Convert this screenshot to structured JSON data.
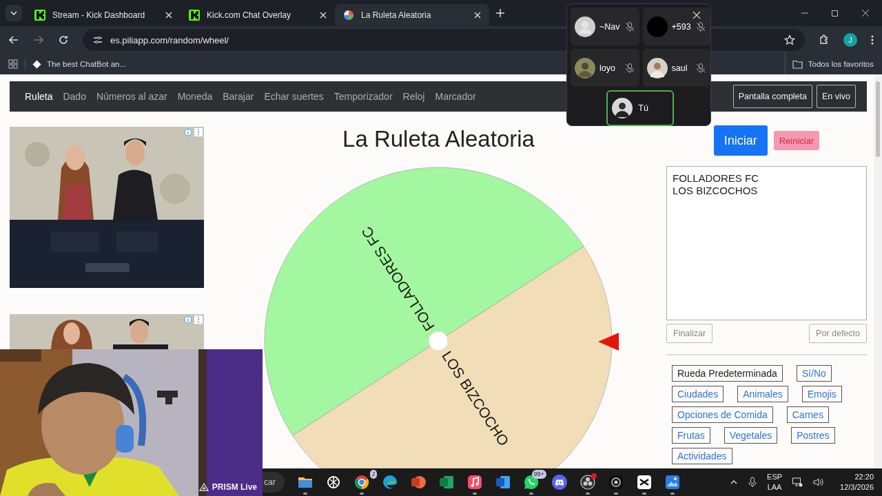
{
  "browser": {
    "tabs": [
      {
        "title": "Stream - Kick Dashboard",
        "selected": false,
        "kind": "kick"
      },
      {
        "title": "Kick.com Chat Overlay",
        "selected": false,
        "kind": "kick"
      },
      {
        "title": "La Ruleta Aleatoria",
        "selected": true,
        "kind": "wheel"
      }
    ],
    "url": "es.piliapp.com/random/wheel/",
    "profile": "J",
    "bookmark": "The best ChatBot an...",
    "all_bookmarks": "Todos los favoritos"
  },
  "nav": {
    "items": [
      {
        "label": "Ruleta",
        "selected": true
      },
      {
        "label": "Dado",
        "selected": false
      },
      {
        "label": "Números al azar",
        "selected": false
      },
      {
        "label": "Moneda",
        "selected": false
      },
      {
        "label": "Barajar",
        "selected": false
      },
      {
        "label": "Echar suertes",
        "selected": false
      },
      {
        "label": "Temporizador",
        "selected": false
      },
      {
        "label": "Reloj",
        "selected": false
      },
      {
        "label": "Marcador",
        "selected": false
      }
    ],
    "buttons": [
      "Pantalla completa",
      "En vivo"
    ]
  },
  "title": "La Ruleta Aleatoria",
  "actions": {
    "start": "Iniciar",
    "reset": "Reiniciar"
  },
  "wheel": {
    "segments": [
      {
        "label": "FOLLADORES FC",
        "color": "#a3f7a0"
      },
      {
        "label": "LOS BIZCOCHO",
        "color": "#f1deb8"
      }
    ]
  },
  "entries": "FOLLADORES FC\nLOS BIZCOCHOS",
  "entry_buttons": [
    "Finalizar",
    "Por defecto"
  ],
  "presets": [
    {
      "label": "Rueda Predeterminada",
      "selected": true
    },
    {
      "label": "Sí/No",
      "selected": false
    },
    {
      "label": "Ciudades",
      "selected": false
    },
    {
      "label": "Animales",
      "selected": false
    },
    {
      "label": "Emojis",
      "selected": false
    },
    {
      "label": "Opciones de Comida",
      "selected": false
    },
    {
      "label": "Carnes",
      "selected": false
    },
    {
      "label": "Frutas",
      "selected": false
    },
    {
      "label": "Vegetales",
      "selected": false
    },
    {
      "label": "Postres",
      "selected": false
    },
    {
      "label": "Actividades",
      "selected": false
    }
  ],
  "call": {
    "participants": [
      {
        "name": "~Nav",
        "kind": "default",
        "muted": true
      },
      {
        "name": "+593",
        "kind": "blank",
        "muted": true
      },
      {
        "name": "loyo",
        "muted": true
      },
      {
        "name": "saul",
        "muted": true
      }
    ],
    "self": {
      "name": "Tú"
    }
  },
  "webcam": {
    "kind": "picture",
    "badge": "PRISM Live"
  },
  "taskbar": {
    "search": "car",
    "apps": [
      {
        "kind": "explorer",
        "running": true
      },
      {
        "kind": "chatgpt",
        "running": false
      },
      {
        "kind": "chrome",
        "running": true,
        "badge": "J"
      },
      {
        "kind": "edge",
        "running": false
      },
      {
        "kind": "powerpoint",
        "running": false
      },
      {
        "kind": "excel",
        "running": false
      },
      {
        "kind": "music",
        "running": true
      },
      {
        "kind": "word",
        "running": false
      },
      {
        "kind": "whatsapp",
        "running": true,
        "badge": "99+"
      },
      {
        "kind": "discord",
        "running": false
      },
      {
        "kind": "obs",
        "running": true,
        "alert": true
      },
      {
        "kind": "camera",
        "running": true
      },
      {
        "kind": "capcut",
        "running": true
      },
      {
        "kind": "photos",
        "running": true
      }
    ],
    "language": [
      "ESP",
      "LAA"
    ],
    "time": "22:20",
    "date": "12/3/2026"
  }
}
